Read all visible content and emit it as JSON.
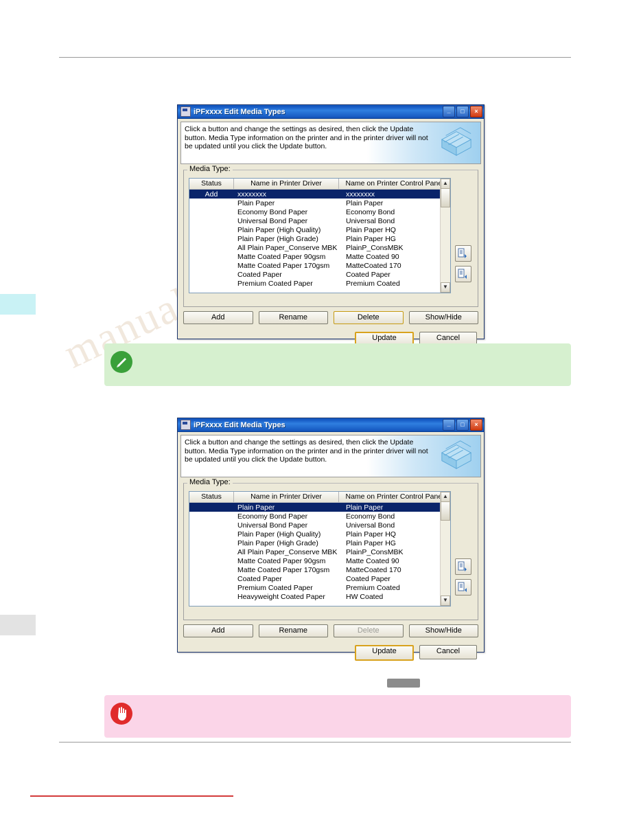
{
  "page": {
    "watermark_text": "manualmachine.com"
  },
  "dialogs": [
    {
      "id": "dialog-add",
      "title": "iPFxxxx Edit Media Types",
      "titlebar_buttons": [
        {
          "name": "minimize-button",
          "glyph": "_"
        },
        {
          "name": "maximize-button",
          "glyph": "□"
        },
        {
          "name": "close-button",
          "glyph": "×"
        }
      ],
      "instruction": "Click a button and change the settings as desired, then click the Update button. Media Type information on the printer and in the printer driver will not be updated until you click the Update button.",
      "group_label": "Media Type:",
      "columns": [
        "Status",
        "Name in Printer Driver",
        "Name on Printer Control Panel"
      ],
      "rows": [
        {
          "status": "Add",
          "driver": "xxxxxxxx",
          "panel": "xxxxxxxx",
          "selected": true
        },
        {
          "status": "",
          "driver": "Plain Paper",
          "panel": "Plain Paper",
          "selected": false
        },
        {
          "status": "",
          "driver": "Economy Bond Paper",
          "panel": "Economy Bond",
          "selected": false
        },
        {
          "status": "",
          "driver": "Universal Bond Paper",
          "panel": "Universal Bond",
          "selected": false
        },
        {
          "status": "",
          "driver": "Plain Paper (High Quality)",
          "panel": "Plain Paper HQ",
          "selected": false
        },
        {
          "status": "",
          "driver": "Plain Paper (High Grade)",
          "panel": "Plain Paper HG",
          "selected": false
        },
        {
          "status": "",
          "driver": "All Plain Paper_Conserve MBK",
          "panel": "PlainP_ConsMBK",
          "selected": false
        },
        {
          "status": "",
          "driver": "Matte Coated Paper 90gsm",
          "panel": "Matte Coated 90",
          "selected": false
        },
        {
          "status": "",
          "driver": "Matte Coated Paper 170gsm",
          "panel": "MatteCoated 170",
          "selected": false
        },
        {
          "status": "",
          "driver": "Coated Paper",
          "panel": "Coated Paper",
          "selected": false
        },
        {
          "status": "",
          "driver": "Premium Coated Paper",
          "panel": "Premium Coated",
          "selected": false
        }
      ],
      "buttons": [
        "Add",
        "Rename",
        "Delete",
        "Show/Hide"
      ],
      "delete_disabled": false,
      "delete_highlighted": true,
      "footer_buttons": [
        "Update",
        "Cancel"
      ]
    },
    {
      "id": "dialog-plain",
      "title": "iPFxxxx Edit Media Types",
      "titlebar_buttons": [
        {
          "name": "minimize-button",
          "glyph": "_"
        },
        {
          "name": "maximize-button",
          "glyph": "□"
        },
        {
          "name": "close-button",
          "glyph": "×"
        }
      ],
      "instruction": "Click a button and change the settings as desired, then click the Update button. Media Type information on the printer and in the printer driver will not be updated until you click the Update button.",
      "group_label": "Media Type:",
      "columns": [
        "Status",
        "Name in Printer Driver",
        "Name on Printer Control Panel"
      ],
      "rows": [
        {
          "status": "",
          "driver": "Plain Paper",
          "panel": "Plain Paper",
          "selected": true
        },
        {
          "status": "",
          "driver": "Economy Bond Paper",
          "panel": "Economy Bond",
          "selected": false
        },
        {
          "status": "",
          "driver": "Universal Bond Paper",
          "panel": "Universal Bond",
          "selected": false
        },
        {
          "status": "",
          "driver": "Plain Paper (High Quality)",
          "panel": "Plain Paper HQ",
          "selected": false
        },
        {
          "status": "",
          "driver": "Plain Paper (High Grade)",
          "panel": "Plain Paper HG",
          "selected": false
        },
        {
          "status": "",
          "driver": "All Plain Paper_Conserve MBK",
          "panel": "PlainP_ConsMBK",
          "selected": false
        },
        {
          "status": "",
          "driver": "Matte Coated Paper 90gsm",
          "panel": "Matte Coated 90",
          "selected": false
        },
        {
          "status": "",
          "driver": "Matte Coated Paper 170gsm",
          "panel": "MatteCoated 170",
          "selected": false
        },
        {
          "status": "",
          "driver": "Coated Paper",
          "panel": "Coated Paper",
          "selected": false
        },
        {
          "status": "",
          "driver": "Premium Coated Paper",
          "panel": "Premium Coated",
          "selected": false
        },
        {
          "status": "",
          "driver": "Heavyweight Coated Paper",
          "panel": "HW Coated",
          "selected": false
        }
      ],
      "buttons": [
        "Add",
        "Rename",
        "Delete",
        "Show/Hide"
      ],
      "delete_disabled": true,
      "delete_highlighted": false,
      "footer_buttons": [
        "Update",
        "Cancel"
      ]
    }
  ],
  "callouts": [
    {
      "name": "note-callout",
      "icon": "pencil-note-icon",
      "color": "#d6f0cf",
      "text": ""
    },
    {
      "name": "warning-callout",
      "icon": "stop-hand-icon",
      "color": "#fbd5e8",
      "text": ""
    }
  ]
}
